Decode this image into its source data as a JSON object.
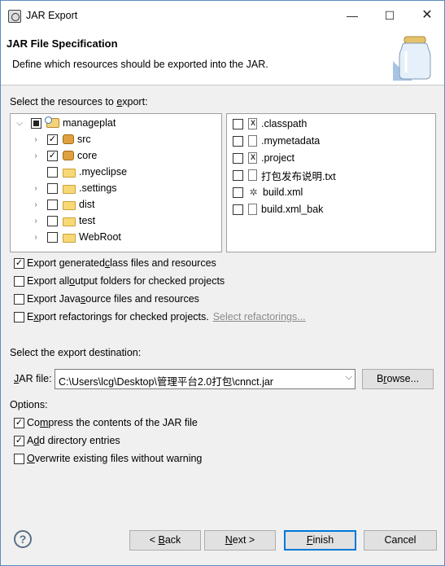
{
  "window": {
    "title": "JAR Export",
    "minimize_glyph": "—",
    "maximize_glyph": "☐",
    "close_glyph": "✕"
  },
  "header": {
    "title": "JAR File Specification",
    "description": "Define which resources should be exported into the JAR."
  },
  "resources": {
    "label_pre": "Select the resources to ",
    "label_mnemonic": "e",
    "label_post": "xport:",
    "tree": [
      {
        "label": "manageplat",
        "expanded": true,
        "check": "partial",
        "icon": "project-icon"
      },
      {
        "label": "src",
        "expanded": false,
        "check": "checked",
        "icon": "package-icon"
      },
      {
        "label": "core",
        "expanded": false,
        "check": "checked",
        "icon": "package-icon"
      },
      {
        "label": ".myeclipse",
        "expanded": null,
        "check": "unchecked",
        "icon": "folder-icon"
      },
      {
        "label": ".settings",
        "expanded": false,
        "check": "unchecked",
        "icon": "folder-icon"
      },
      {
        "label": "dist",
        "expanded": false,
        "check": "unchecked",
        "icon": "folder-icon"
      },
      {
        "label": "test",
        "expanded": false,
        "check": "unchecked",
        "icon": "folder-icon"
      },
      {
        "label": "WebRoot",
        "expanded": false,
        "check": "unchecked",
        "icon": "folder-icon"
      }
    ],
    "files": [
      {
        "label": ".classpath",
        "check": "unchecked",
        "icon": "xml-file-icon"
      },
      {
        "label": ".mymetadata",
        "check": "unchecked",
        "icon": "file-icon"
      },
      {
        "label": ".project",
        "check": "unchecked",
        "icon": "xml-file-icon"
      },
      {
        "label": "打包发布说明.txt",
        "check": "unchecked",
        "icon": "text-file-icon"
      },
      {
        "label": "build.xml",
        "check": "unchecked",
        "icon": "ant-icon"
      },
      {
        "label": "build.xml_bak",
        "check": "unchecked",
        "icon": "file-icon"
      }
    ]
  },
  "options_top": [
    {
      "pre": "Export generated ",
      "mn": "c",
      "post": "lass files and resources",
      "checked": true
    },
    {
      "pre": "Export all ",
      "mn": "o",
      "post": "utput folders for checked projects",
      "checked": false
    },
    {
      "pre": "Export Java ",
      "mn": "s",
      "post": "ource files and resources",
      "checked": false
    },
    {
      "pre": "E",
      "mn": "x",
      "post": "port refactorings for checked projects.",
      "checked": false
    }
  ],
  "select_refactorings_link": "Select refactorings...",
  "destination": {
    "label": "Select the export destination:",
    "jar_label_mn": "J",
    "jar_label_post": "AR file:",
    "jar_path": "C:\\Users\\lcg\\Desktop\\管理平台2.0打包\\cnnct.jar",
    "browse_pre": "B",
    "browse_mn": "r",
    "browse_post": "owse..."
  },
  "options": {
    "label": "Options:",
    "items": [
      {
        "pre": "Co",
        "mn": "m",
        "post": "press the contents of the JAR file",
        "checked": true
      },
      {
        "pre": "A",
        "mn": "d",
        "post": "d directory entries",
        "checked": true
      },
      {
        "pre": "",
        "mn": "O",
        "post": "verwrite existing files without warning",
        "checked": false
      }
    ]
  },
  "footer": {
    "help": "?",
    "back_pre": "< ",
    "back_mn": "B",
    "back_post": "ack",
    "next_mn": "N",
    "next_post": "ext >",
    "finish_mn": "F",
    "finish_post": "inish",
    "cancel": "Cancel"
  },
  "colors": {
    "accent": "#0078d7",
    "link": "#8a8a8a"
  }
}
